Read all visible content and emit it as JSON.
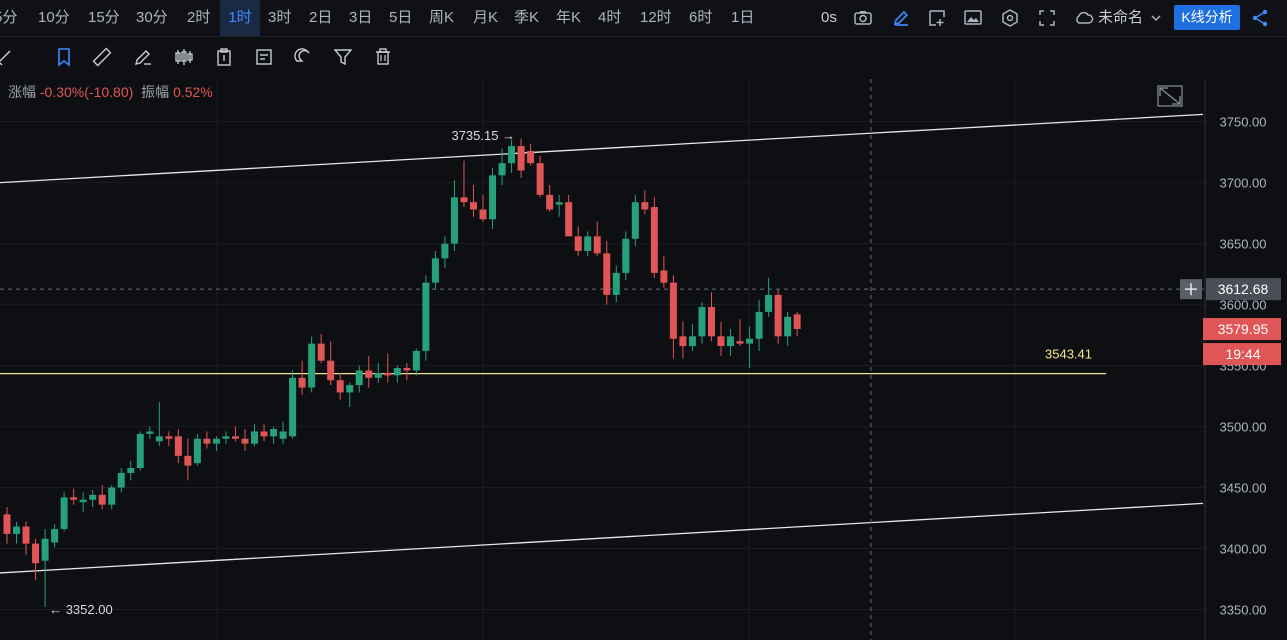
{
  "timeframes": [
    "5分",
    "10分",
    "15分",
    "30分",
    "2时",
    "1时",
    "3时",
    "2日",
    "3日",
    "5日",
    "周K",
    "月K",
    "季K",
    "年K",
    "4时",
    "12时",
    "6时",
    "1日"
  ],
  "active_timeframe": "1时",
  "header_right": {
    "countdown": "0s",
    "chart_name": "未命名",
    "analysis_button": "K线分析"
  },
  "drawing_tools": [
    "cross-tool-icon",
    "bookmark-icon",
    "ruler-icon",
    "pen-icon",
    "candles-icon",
    "clipboard-icon",
    "note-icon",
    "magnet-icon",
    "filter-icon",
    "trash-icon"
  ],
  "info": {
    "change_label": "涨幅",
    "change_value": "-0.30%(-10.80)",
    "amplitude_label": "振幅",
    "amplitude_value": "0.52%"
  },
  "colors": {
    "up": "#26a17b",
    "down": "#e05555",
    "support": "#f0e68c",
    "accent": "#3d8bff"
  },
  "chart_data": {
    "type": "candlestick",
    "ylim": [
      3325,
      3785
    ],
    "y_ticks": [
      3350,
      3400,
      3450,
      3500,
      3550,
      3600,
      3650,
      3700,
      3750
    ],
    "y_tick_labels": [
      "3350.00",
      "3400.00",
      "3450.00",
      "3500.00",
      "3550.00",
      "3600.00",
      "3650.00",
      "3700.00",
      "3750.00"
    ],
    "candles": [
      [
        3428,
        3434,
        3404,
        3412
      ],
      [
        3412,
        3422,
        3404,
        3418
      ],
      [
        3418,
        3422,
        3395,
        3404
      ],
      [
        3404,
        3408,
        3374,
        3388
      ],
      [
        3390,
        3416,
        3352,
        3408
      ],
      [
        3405,
        3420,
        3401,
        3416
      ],
      [
        3416,
        3446,
        3414,
        3442
      ],
      [
        3442,
        3449,
        3436,
        3440
      ],
      [
        3438,
        3446,
        3430,
        3440
      ],
      [
        3440,
        3448,
        3434,
        3444
      ],
      [
        3444,
        3452,
        3432,
        3436
      ],
      [
        3436,
        3452,
        3432,
        3450
      ],
      [
        3450,
        3466,
        3446,
        3462
      ],
      [
        3462,
        3472,
        3456,
        3466
      ],
      [
        3466,
        3496,
        3464,
        3494
      ],
      [
        3494,
        3500,
        3490,
        3496
      ],
      [
        3488,
        3520,
        3484,
        3492
      ],
      [
        3492,
        3496,
        3484,
        3490
      ],
      [
        3492,
        3498,
        3470,
        3476
      ],
      [
        3476,
        3490,
        3456,
        3468
      ],
      [
        3470,
        3494,
        3468,
        3490
      ],
      [
        3490,
        3496,
        3482,
        3486
      ],
      [
        3486,
        3492,
        3480,
        3490
      ],
      [
        3490,
        3496,
        3486,
        3492
      ],
      [
        3492,
        3500,
        3488,
        3490
      ],
      [
        3490,
        3498,
        3480,
        3486
      ],
      [
        3486,
        3502,
        3484,
        3496
      ],
      [
        3496,
        3502,
        3488,
        3492
      ],
      [
        3492,
        3500,
        3486,
        3498
      ],
      [
        3490,
        3504,
        3486,
        3496
      ],
      [
        3492,
        3546,
        3490,
        3540
      ],
      [
        3540,
        3554,
        3526,
        3532
      ],
      [
        3532,
        3574,
        3528,
        3568
      ],
      [
        3568,
        3576,
        3552,
        3554
      ],
      [
        3554,
        3570,
        3534,
        3538
      ],
      [
        3538,
        3544,
        3522,
        3528
      ],
      [
        3528,
        3536,
        3516,
        3534
      ],
      [
        3534,
        3550,
        3528,
        3546
      ],
      [
        3546,
        3558,
        3532,
        3540
      ],
      [
        3540,
        3552,
        3536,
        3544
      ],
      [
        3544,
        3560,
        3536,
        3542
      ],
      [
        3542,
        3550,
        3536,
        3548
      ],
      [
        3548,
        3552,
        3538,
        3546
      ],
      [
        3546,
        3564,
        3542,
        3562
      ],
      [
        3562,
        3624,
        3554,
        3618
      ],
      [
        3618,
        3644,
        3612,
        3638
      ],
      [
        3638,
        3656,
        3630,
        3650
      ],
      [
        3650,
        3702,
        3644,
        3688
      ],
      [
        3688,
        3718,
        3680,
        3684
      ],
      [
        3684,
        3698,
        3672,
        3678
      ],
      [
        3678,
        3690,
        3668,
        3670
      ],
      [
        3670,
        3712,
        3662,
        3706
      ],
      [
        3706,
        3728,
        3698,
        3716
      ],
      [
        3716,
        3735,
        3708,
        3730
      ],
      [
        3730,
        3736,
        3704,
        3710
      ],
      [
        3726,
        3732,
        3714,
        3716
      ],
      [
        3716,
        3722,
        3688,
        3690
      ],
      [
        3690,
        3698,
        3676,
        3678
      ],
      [
        3682,
        3690,
        3672,
        3684
      ],
      [
        3684,
        3690,
        3662,
        3656
      ],
      [
        3656,
        3664,
        3640,
        3644
      ],
      [
        3644,
        3660,
        3640,
        3656
      ],
      [
        3656,
        3668,
        3640,
        3642
      ],
      [
        3642,
        3652,
        3600,
        3608
      ],
      [
        3608,
        3632,
        3602,
        3626
      ],
      [
        3626,
        3660,
        3620,
        3654
      ],
      [
        3654,
        3690,
        3648,
        3684
      ],
      [
        3684,
        3694,
        3674,
        3678
      ],
      [
        3680,
        3688,
        3622,
        3626
      ],
      [
        3628,
        3640,
        3614,
        3618
      ],
      [
        3618,
        3624,
        3556,
        3572
      ],
      [
        3574,
        3586,
        3556,
        3566
      ],
      [
        3566,
        3584,
        3562,
        3574
      ],
      [
        3574,
        3602,
        3568,
        3598
      ],
      [
        3598,
        3610,
        3570,
        3574
      ],
      [
        3574,
        3586,
        3558,
        3566
      ],
      [
        3566,
        3580,
        3558,
        3574
      ],
      [
        3570,
        3588,
        3566,
        3568
      ],
      [
        3568,
        3582,
        3548,
        3572
      ],
      [
        3572,
        3604,
        3562,
        3594
      ],
      [
        3594,
        3622,
        3590,
        3608
      ],
      [
        3608,
        3612,
        3568,
        3574
      ],
      [
        3574,
        3594,
        3566,
        3590
      ],
      [
        3592,
        3594,
        3574,
        3580
      ]
    ],
    "high_label": "3735.15",
    "low_label": "3352.00",
    "support_level": 3543.41,
    "support_label": "3543.41",
    "crosshair_price_label": "3612.68",
    "crosshair_price": 3612.68,
    "last_price_label": "3579.95",
    "last_price": 3579.95,
    "countdown_label": "19:44",
    "channel_upper": [
      3700,
      3756
    ],
    "channel_lower": [
      3380,
      3437
    ]
  }
}
